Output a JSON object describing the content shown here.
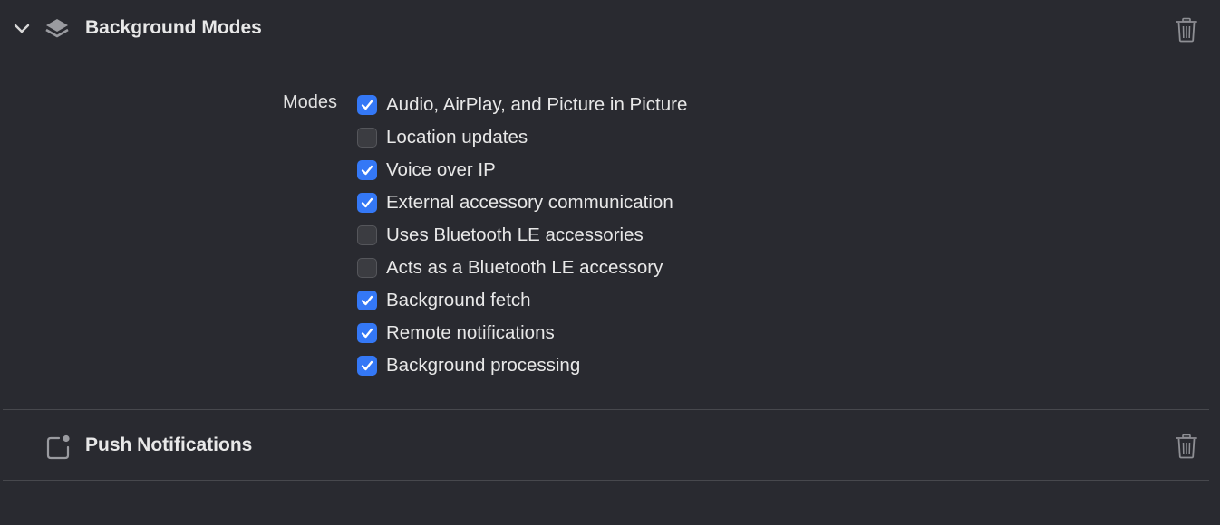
{
  "sections": [
    {
      "title": "Background Modes",
      "icon": "layers-icon",
      "expanded": true,
      "modes_label": "Modes",
      "modes": [
        {
          "label": "Audio, AirPlay, and Picture in Picture",
          "checked": true
        },
        {
          "label": "Location updates",
          "checked": false
        },
        {
          "label": "Voice over IP",
          "checked": true
        },
        {
          "label": "External accessory communication",
          "checked": true
        },
        {
          "label": "Uses Bluetooth LE accessories",
          "checked": false
        },
        {
          "label": "Acts as a Bluetooth LE accessory",
          "checked": false
        },
        {
          "label": "Background fetch",
          "checked": true
        },
        {
          "label": "Remote notifications",
          "checked": true
        },
        {
          "label": "Background processing",
          "checked": true
        }
      ]
    },
    {
      "title": "Push Notifications",
      "icon": "notification-badge-icon"
    }
  ],
  "colors": {
    "background": "#292a30",
    "checkbox_on": "#3478f6",
    "checkbox_off": "#3b3c41",
    "divider": "#47484d"
  }
}
